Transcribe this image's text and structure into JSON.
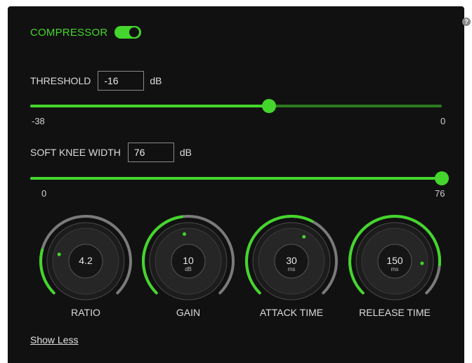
{
  "colors": {
    "accent": "#44d62c",
    "accent_dim": "#2c7a1f",
    "panel_bg": "#111111",
    "knob_track": "#7a7a7a",
    "knob_face": "#262626"
  },
  "help_icon": {
    "glyph": "?"
  },
  "compressor": {
    "label": "COMPRESSOR",
    "enabled": true
  },
  "threshold": {
    "label": "THRESHOLD",
    "value": "-16",
    "unit": "dB",
    "min": -38,
    "max": 0,
    "min_label": "-38",
    "max_label": "0",
    "level": 0.58
  },
  "soft_knee": {
    "label": "SOFT KNEE WIDTH",
    "value": "76",
    "unit": "dB",
    "min": 0,
    "max": 76,
    "min_label": "0",
    "max_label": "76",
    "level": 1.0
  },
  "knobs": [
    {
      "label": "RATIO",
      "value": "4.2",
      "unit": "",
      "level": 0.22
    },
    {
      "label": "GAIN",
      "value": "10",
      "unit": "dB",
      "level": 0.47
    },
    {
      "label": "ATTACK TIME",
      "value": "30",
      "unit": "ms",
      "level": 0.6
    },
    {
      "label": "RELEASE TIME",
      "value": "150",
      "unit": "ms",
      "level": 0.85
    }
  ],
  "footer": {
    "show_less": "Show Less"
  }
}
